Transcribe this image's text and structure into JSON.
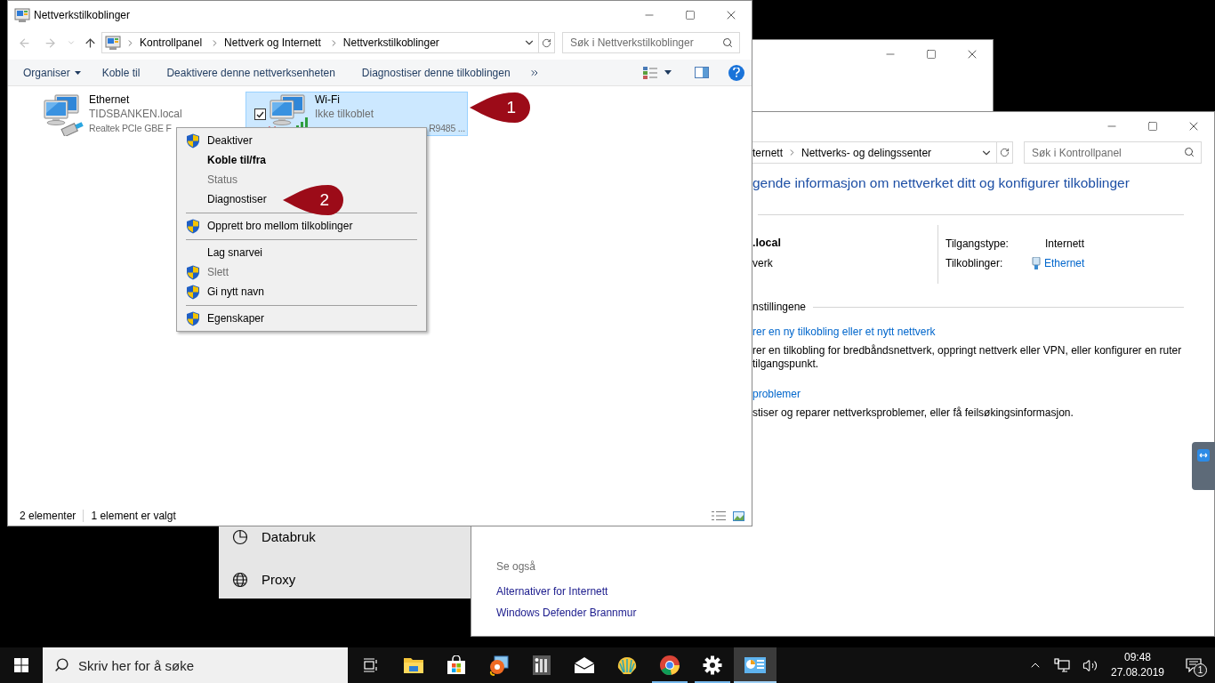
{
  "window_back": {
    "nav_items": [
      {
        "kind": "data-usage",
        "label": "Databruk"
      },
      {
        "kind": "proxy",
        "label": "Proxy"
      }
    ]
  },
  "window_sharing_center": {
    "address": [
      "ternett",
      "Nettverks- og delingssenter"
    ],
    "search": {
      "placeholder": "Søk i Kontrollpanel"
    },
    "heading": "gende informasjon om nettverket ditt og konfigurer tilkoblinger",
    "network_name": ".local",
    "network_type": "verk",
    "access_type_label": "Tilgangstype:",
    "access_type": "Internett",
    "connections_label": "Tilkoblinger:",
    "connection": "Ethernet",
    "settings_heading": "nstillingene",
    "tasks": [
      {
        "link": "rer en ny tilkobling eller et nytt nettverk",
        "description": "rer en tilkobling for bredbåndsnettverk, oppringt nettverk eller VPN, eller konfigurer en ruter tilgangspunkt."
      },
      {
        "link": "problemer",
        "description": "stiser og reparer nettverksproblemer, eller få feilsøkingsinformasjon."
      }
    ],
    "see_also": {
      "heading": "Se også",
      "links": [
        "Alternativer for Internett",
        "Windows Defender Brannmur"
      ]
    }
  },
  "window_main": {
    "title": "Nettverkstilkoblinger",
    "breadcrumbs": [
      "Kontrollpanel",
      "Nettverk og Internett",
      "Nettverkstilkoblinger"
    ],
    "search": {
      "placeholder": "Søk i Nettverkstilkoblinger"
    },
    "toolbar": [
      {
        "kind": "menu",
        "label": "Organiser"
      },
      {
        "kind": "button",
        "label": "Koble til"
      },
      {
        "kind": "button",
        "label": "Deaktivere denne nettverksenheten"
      },
      {
        "kind": "button",
        "label": "Diagnostiser denne tilkoblingen"
      }
    ],
    "items": [
      {
        "kind": "ethernet",
        "name": "Ethernet",
        "status": "TIDSBANKEN.local",
        "device": "Realtek PCIe GBE F",
        "selected": false
      },
      {
        "kind": "wifi",
        "name": "Wi-Fi",
        "status": "Ikke tilkoblet",
        "device": "R9485 ...",
        "selected": true
      }
    ],
    "status_bar": {
      "count": "2 elementer",
      "selection": "1 element er valgt"
    }
  },
  "context_menu": [
    {
      "kind": "item",
      "label": "Deaktiver",
      "shield": true,
      "bold": false,
      "disabled": false
    },
    {
      "kind": "item",
      "label": "Koble til/fra",
      "shield": false,
      "bold": true,
      "disabled": false
    },
    {
      "kind": "item",
      "label": "Status",
      "shield": false,
      "bold": false,
      "disabled": true
    },
    {
      "kind": "item",
      "label": "Diagnostiser",
      "shield": false,
      "bold": false,
      "disabled": false
    },
    {
      "kind": "separator"
    },
    {
      "kind": "item",
      "label": "Opprett bro mellom tilkoblinger",
      "shield": true,
      "bold": false,
      "disabled": false
    },
    {
      "kind": "separator"
    },
    {
      "kind": "item",
      "label": "Lag snarvei",
      "shield": false,
      "bold": false,
      "disabled": false
    },
    {
      "kind": "item",
      "label": "Slett",
      "shield": true,
      "bold": false,
      "disabled": true
    },
    {
      "kind": "item",
      "label": "Gi nytt navn",
      "shield": true,
      "bold": false,
      "disabled": false
    },
    {
      "kind": "separator"
    },
    {
      "kind": "item",
      "label": "Egenskaper",
      "shield": true,
      "bold": false,
      "disabled": false
    }
  ],
  "callouts": [
    {
      "number": "1"
    },
    {
      "number": "2"
    }
  ],
  "taskbar": {
    "search": {
      "placeholder": "Skriv her for å søke"
    },
    "apps": [
      {
        "kind": "explorer",
        "running": false,
        "active": false
      },
      {
        "kind": "store",
        "running": false,
        "active": false
      },
      {
        "kind": "paint",
        "running": false,
        "active": false
      },
      {
        "kind": "calculator",
        "running": false,
        "active": false
      },
      {
        "kind": "mail",
        "running": false,
        "active": false
      },
      {
        "kind": "shell",
        "running": false,
        "active": false
      },
      {
        "kind": "browser",
        "running": true,
        "active": false
      },
      {
        "kind": "settings",
        "running": true,
        "active": false
      },
      {
        "kind": "control-panel",
        "running": true,
        "active": true
      }
    ],
    "time": "09:48",
    "date": "27.08.2019",
    "notifications": "1"
  }
}
